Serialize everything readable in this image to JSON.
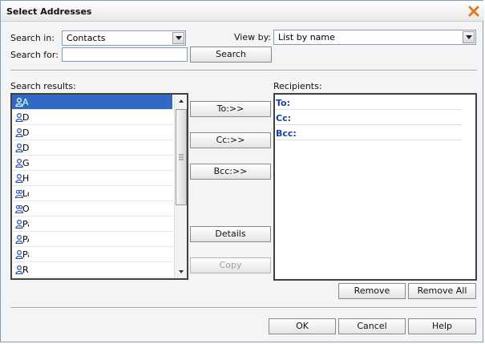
{
  "dialog": {
    "title": "Select Addresses"
  },
  "search": {
    "search_in_label": "Search in:",
    "search_in_value": "Contacts",
    "view_by_label": "View by:",
    "view_by_value": "List by name",
    "search_for_label": "Search for:",
    "search_for_value": "",
    "search_button": "Search"
  },
  "results": {
    "label": "Search results:",
    "items": [
      {
        "text": "Ar",
        "icon": "person-icon",
        "selected": true
      },
      {
        "text": "D:",
        "icon": "person-icon"
      },
      {
        "text": "De",
        "icon": "person-icon"
      },
      {
        "text": "Dy",
        "icon": "person-icon"
      },
      {
        "text": "Gl",
        "icon": "person-icon"
      },
      {
        "text": "He",
        "icon": "person-icon"
      },
      {
        "text": "Lo",
        "icon": "group-icon"
      },
      {
        "text": "O'",
        "icon": "group-icon"
      },
      {
        "text": "Pa",
        "icon": "person-icon"
      },
      {
        "text": "PA",
        "icon": "person-icon"
      },
      {
        "text": "Pa",
        "icon": "person-icon"
      },
      {
        "text": "Ri",
        "icon": "person-icon"
      }
    ]
  },
  "actions": {
    "to": "To:>>",
    "cc": "Cc:>>",
    "bcc": "Bcc:>>",
    "details": "Details",
    "copy": "Copy"
  },
  "recipients": {
    "label": "Recipients:",
    "to": "To:",
    "cc": "Cc:",
    "bcc": "Bcc:",
    "remove": "Remove",
    "remove_all": "Remove All"
  },
  "footer": {
    "ok": "OK",
    "cancel": "Cancel",
    "help": "Help"
  },
  "colors": {
    "selection": "#316ac5",
    "recipient_label": "#1a3d9e",
    "close_icon": "#e07a1f"
  }
}
